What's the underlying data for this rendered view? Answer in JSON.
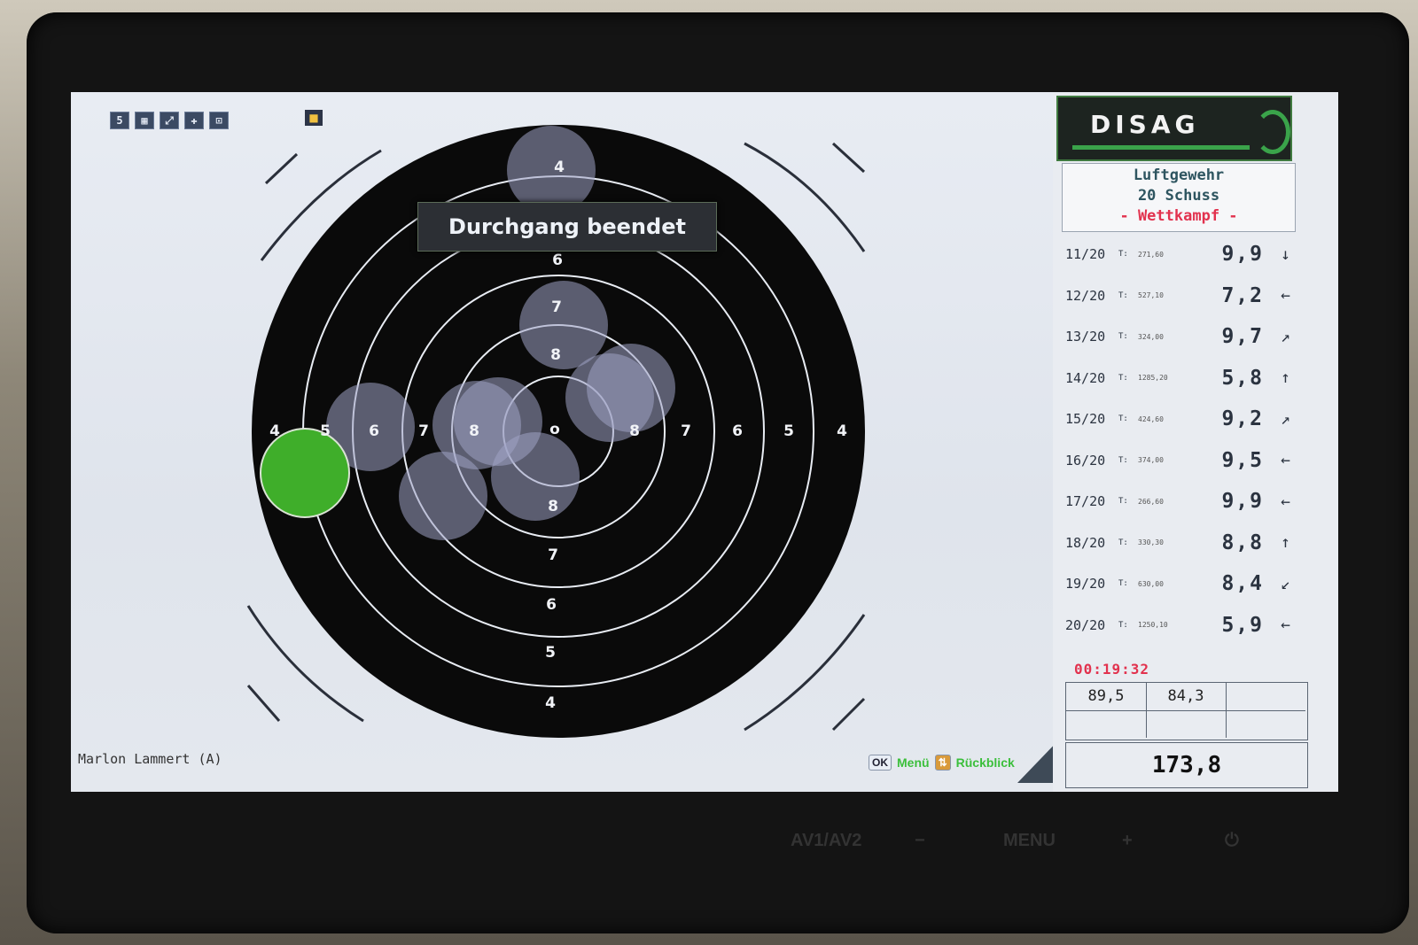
{
  "toolbar": {
    "page_number": "5"
  },
  "target": {
    "banner": "Durchgang beendet",
    "ring_labels": {
      "left": [
        "4",
        "5",
        "6",
        "7",
        "8"
      ],
      "center": "o",
      "right": [
        "8",
        "7",
        "6",
        "5",
        "4"
      ],
      "top": [
        "4",
        "6",
        "7",
        "8"
      ],
      "bottom": [
        "8",
        "7",
        "6",
        "5",
        "4"
      ]
    }
  },
  "shooter_name": "Marlon Lammert (A)",
  "softkeys": {
    "ok_key": "OK",
    "menu_label": "Menü",
    "review_key": "⇅",
    "review_label": "Rückblick"
  },
  "panel": {
    "brand": "DISAG",
    "discipline": "Luftgewehr",
    "shot_count": "20 Schuss",
    "mode": "- Wettkampf -",
    "shots": [
      {
        "num": "11/20",
        "t": "T:",
        "time": "271,60",
        "score": "9,9",
        "dir": "↓"
      },
      {
        "num": "12/20",
        "t": "T:",
        "time": "527,10",
        "score": "7,2",
        "dir": "←"
      },
      {
        "num": "13/20",
        "t": "T:",
        "time": "324,00",
        "score": "9,7",
        "dir": "↗"
      },
      {
        "num": "14/20",
        "t": "T:",
        "time": "1285,20",
        "score": "5,8",
        "dir": "↑"
      },
      {
        "num": "15/20",
        "t": "T:",
        "time": "424,60",
        "score": "9,2",
        "dir": "↗"
      },
      {
        "num": "16/20",
        "t": "T:",
        "time": "374,00",
        "score": "9,5",
        "dir": "←"
      },
      {
        "num": "17/20",
        "t": "T:",
        "time": "266,60",
        "score": "9,9",
        "dir": "←"
      },
      {
        "num": "18/20",
        "t": "T:",
        "time": "330,30",
        "score": "8,8",
        "dir": "↑"
      },
      {
        "num": "19/20",
        "t": "T:",
        "time": "630,00",
        "score": "8,4",
        "dir": "↙"
      },
      {
        "num": "20/20",
        "t": "T:",
        "time": "1250,10",
        "score": "5,9",
        "dir": "←"
      }
    ],
    "timer": "00:19:32",
    "series": [
      "89,5",
      "84,3"
    ],
    "total": "173,8"
  },
  "monitor_buttons": {
    "av": "AV1/AV2",
    "minus": "−",
    "menu": "MENU",
    "plus": "+",
    "power": "⏻"
  },
  "colors": {
    "last_shot": "#3fae2a",
    "shot": "#9ea3c4",
    "target_black": "#0a0a0a",
    "mode_red": "#e2324e",
    "logo_green": "#3aa34a"
  }
}
